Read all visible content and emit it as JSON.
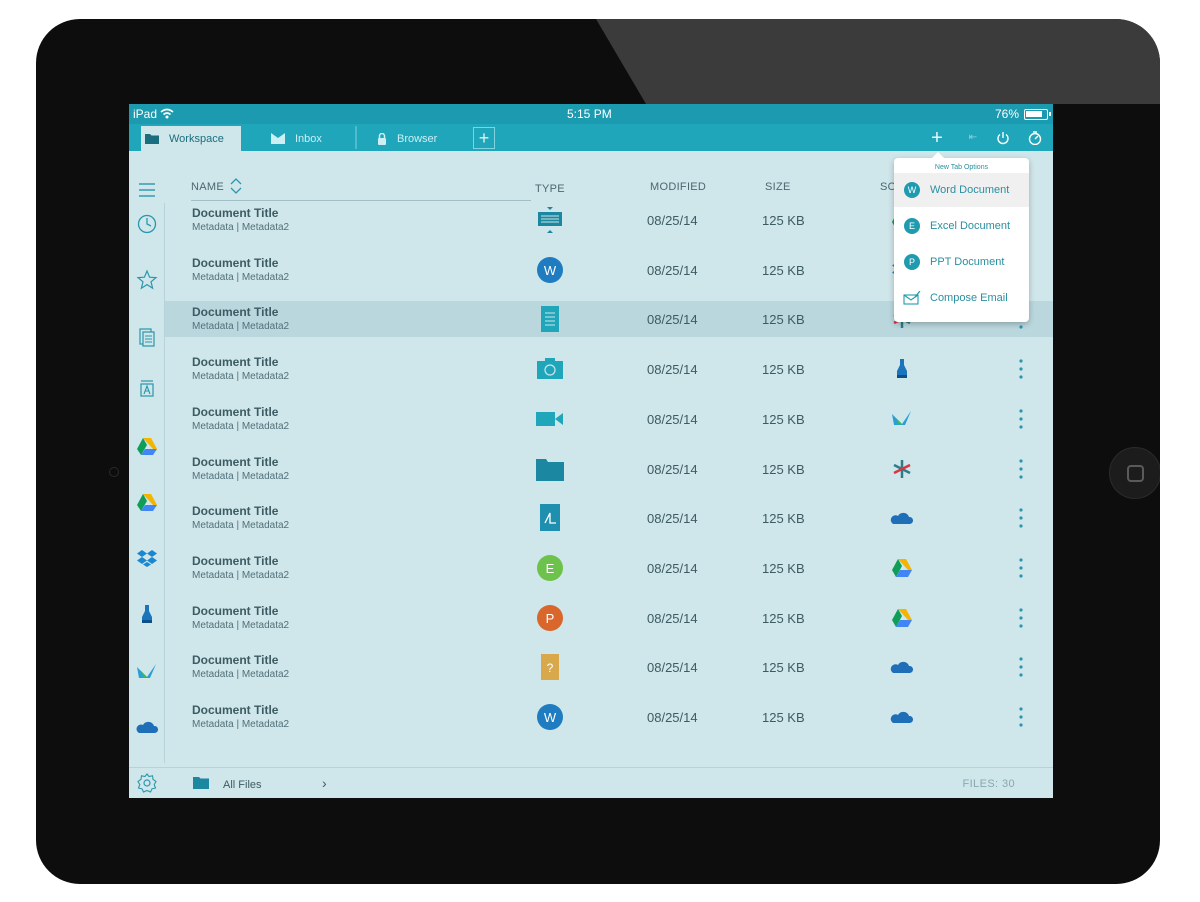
{
  "status_bar": {
    "device": "iPad",
    "time": "5:15 PM",
    "battery": "76%"
  },
  "tabs": [
    {
      "label": "Workspace",
      "icon": "folder-icon",
      "active": true
    },
    {
      "label": "Inbox",
      "icon": "inbox-icon",
      "active": false
    },
    {
      "label": "Browser",
      "icon": "lock-icon",
      "active": false
    }
  ],
  "toolbar": {
    "icons": [
      "plus-icon",
      "back-icon",
      "power-icon",
      "timer-icon"
    ]
  },
  "columns": {
    "name": "NAME",
    "type": "TYPE",
    "modified": "MODIFIED",
    "size": "SIZE",
    "source": "SO"
  },
  "popup": {
    "header": "New Tab Options",
    "items": [
      {
        "letter": "W",
        "label": "Word Document",
        "selected": true
      },
      {
        "letter": "E",
        "label": "Excel Document",
        "selected": false
      },
      {
        "letter": "P",
        "label": "PPT Document",
        "selected": false
      },
      {
        "letter": "",
        "label": "Compose Email",
        "selected": false
      }
    ]
  },
  "rows": [
    {
      "title": "Document Title",
      "meta": "Metadata | Metadata2",
      "modified": "08/25/14",
      "size": "125 KB",
      "type": "presentation-icon",
      "source": "google-drive-icon"
    },
    {
      "title": "Document Title",
      "meta": "Metadata | Metadata2",
      "modified": "08/25/14",
      "size": "125 KB",
      "type": "word-icon",
      "source": "dropbox-icon"
    },
    {
      "title": "Document Title",
      "meta": "Metadata | Metadata2",
      "modified": "08/25/14",
      "size": "125 KB",
      "type": "text-doc-icon",
      "source": "sharefile-icon"
    },
    {
      "title": "Document Title",
      "meta": "Metadata | Metadata2",
      "modified": "08/25/14",
      "size": "125 KB",
      "type": "camera-icon",
      "source": "bottle-icon"
    },
    {
      "title": "Document Title",
      "meta": "Metadata | Metadata2",
      "modified": "08/25/14",
      "size": "125 KB",
      "type": "video-icon",
      "source": "bird-icon"
    },
    {
      "title": "Document Title",
      "meta": "Metadata | Metadata2",
      "modified": "08/25/14",
      "size": "125 KB",
      "type": "folder-icon",
      "source": "sharefile-icon"
    },
    {
      "title": "Document Title",
      "meta": "Metadata | Metadata2",
      "modified": "08/25/14",
      "size": "125 KB",
      "type": "pdf-icon",
      "source": "onedrive-icon"
    },
    {
      "title": "Document Title",
      "meta": "Metadata | Metadata2",
      "modified": "08/25/14",
      "size": "125 KB",
      "type": "excel-icon",
      "source": "google-drive-icon"
    },
    {
      "title": "Document Title",
      "meta": "Metadata | Metadata2",
      "modified": "08/25/14",
      "size": "125 KB",
      "type": "ppt-icon",
      "source": "google-drive-icon"
    },
    {
      "title": "Document Title",
      "meta": "Metadata | Metadata2",
      "modified": "08/25/14",
      "size": "125 KB",
      "type": "unknown-file-icon",
      "source": "onedrive-icon"
    },
    {
      "title": "Document Title",
      "meta": "Metadata | Metadata2",
      "modified": "08/25/14",
      "size": "125 KB",
      "type": "word-icon",
      "source": "onedrive-icon"
    }
  ],
  "footer": {
    "label": "All Files",
    "count": "FILES: 30"
  },
  "colors": {
    "accent": "#1fa6bb",
    "background": "#cfe6ea",
    "text": "#3d5b63"
  }
}
